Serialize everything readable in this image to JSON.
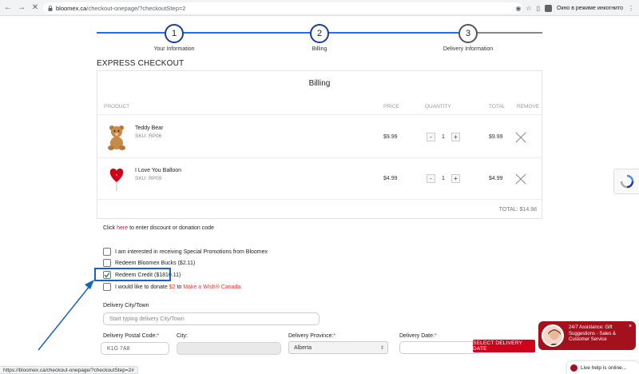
{
  "browser": {
    "url_host": "bloomex.ca",
    "url_path": "/checkout-onepage/?checkoutStep=2",
    "incognito_label": "Окно в режиме инкогнито",
    "status_url": "https://bloomex.ca/checkout-onepage/?checkoutStep=2#"
  },
  "steps": [
    {
      "number": "1",
      "label": "Your Information"
    },
    {
      "number": "2",
      "label": "Billing"
    },
    {
      "number": "3",
      "label": "Delivery Information"
    }
  ],
  "express_checkout": "EXPRESS CHECKOUT",
  "billing": {
    "title": "Billing",
    "headers": {
      "product": "PRODUCT",
      "price": "PRICE",
      "quantity": "QUANTITY",
      "total": "TOTAL",
      "remove": "REMOVE"
    },
    "items": [
      {
        "name": "Teddy Bear",
        "sku": "SKU: RP06",
        "price": "$9.99",
        "qty": "1",
        "total": "$9.99",
        "image": "teddy-bear-icon"
      },
      {
        "name": "I Love You Balloon",
        "sku": "SKU: RP09",
        "price": "$4.99",
        "qty": "1",
        "total": "$4.99",
        "image": "heart-balloon-icon"
      }
    ],
    "qty_minus": "-",
    "qty_plus": "+",
    "grand_total": "TOTAL: $14.98"
  },
  "discount": {
    "prefix": "Click ",
    "link": "here",
    "suffix": " to enter discount or donation code"
  },
  "options": [
    {
      "label": "I am interested in receiving Special Promotions from Bloomex",
      "checked": false
    },
    {
      "label": "Redeem Bloomex Bucks ($2.11)",
      "checked": false
    },
    {
      "label": "Redeem Credit ($1810.11)",
      "checked": true
    }
  ],
  "donate": {
    "prefix": "I would like to donate ",
    "amount": "$2",
    "middle": " to ",
    "link": "Make a Wish® Canada"
  },
  "delivery": {
    "city_town_label": "Delivery City/Town",
    "city_town_placeholder": "Start typing delivery City/Town",
    "postal_label": "Delivery Postal Code:",
    "postal_value": "K1G 7A8",
    "city_label": "City:",
    "province_label": "Delivery Province:",
    "province_value": "Alberta",
    "date_label": "Delivery Date:",
    "required_mark": "*",
    "date_button": "SELECT DELIVERY DATE"
  },
  "chat": {
    "message": "24/7 Assistance: Gift Suggestions - Sales & Customer Service",
    "close": "×",
    "live_help": "Live help is online..."
  },
  "colors": {
    "accent": "#1a73e8",
    "brand_red": "#d0021b",
    "chat_red": "#a3111d",
    "annotation_blue": "#1565c0"
  }
}
